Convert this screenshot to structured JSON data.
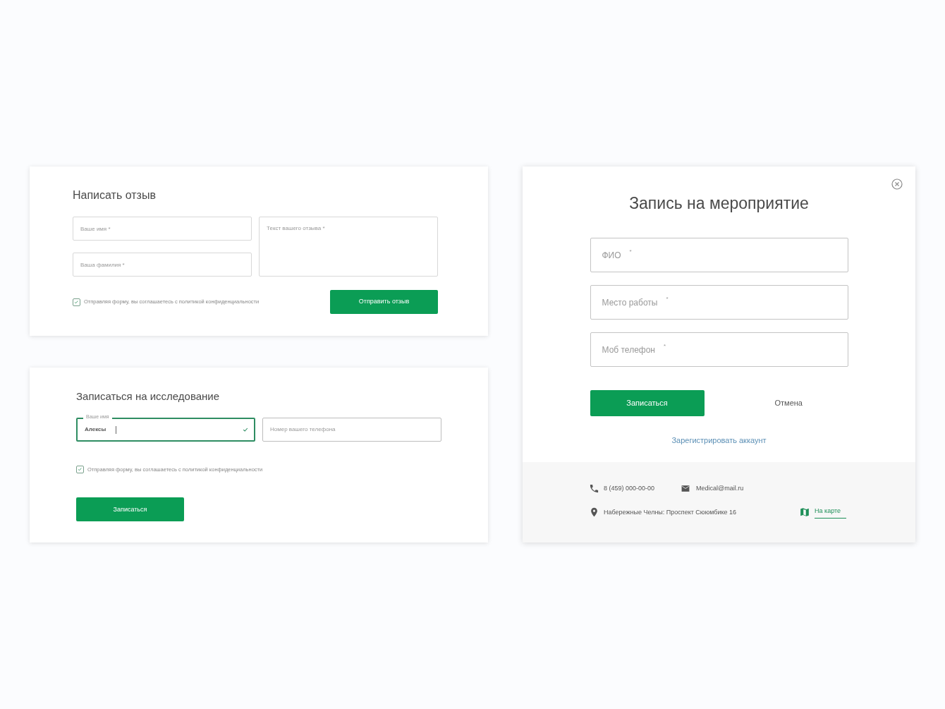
{
  "review_form": {
    "title": "Написать отзыв",
    "fields": [
      {
        "placeholder": "Ваше имя *"
      },
      {
        "placeholder": "Ваша фамилия *"
      }
    ],
    "textarea": {
      "placeholder": "Текст вашего отзыва *"
    },
    "consent": {
      "label": "Отправляя форму, вы соглашаетесь с политикой конфиденциальности",
      "checked": true
    },
    "submit": "Отправить отзыв"
  },
  "study_form": {
    "title": "Записаться на исследование",
    "fields": [
      {
        "label": "Ваше имя",
        "value": "Алексы",
        "focused": true,
        "valid": true
      },
      {
        "placeholder": "Номер вашего телефона",
        "focused": false,
        "valid": false
      }
    ],
    "consent": {
      "label": "Отправляя форму, вы соглашаетесь с политикой конфиденциальности",
      "checked": true
    },
    "submit": "Записаться"
  },
  "event_dialog": {
    "title": "Запись на мероприятие",
    "fields": [
      {
        "placeholder": "ФИО"
      },
      {
        "placeholder": "Место работы"
      },
      {
        "placeholder": "Моб телефон"
      }
    ],
    "required_mark": "*",
    "submit": "Записаться",
    "cancel": "Отмена",
    "register_link": "Зарегистрировать аккаунт",
    "contacts": {
      "phone": "8 (459) 000-00-00",
      "email": "Medical@mail.ru",
      "address": "Набережные Челны: Проспект Сююмбике 16",
      "map_link": "На карте"
    }
  }
}
